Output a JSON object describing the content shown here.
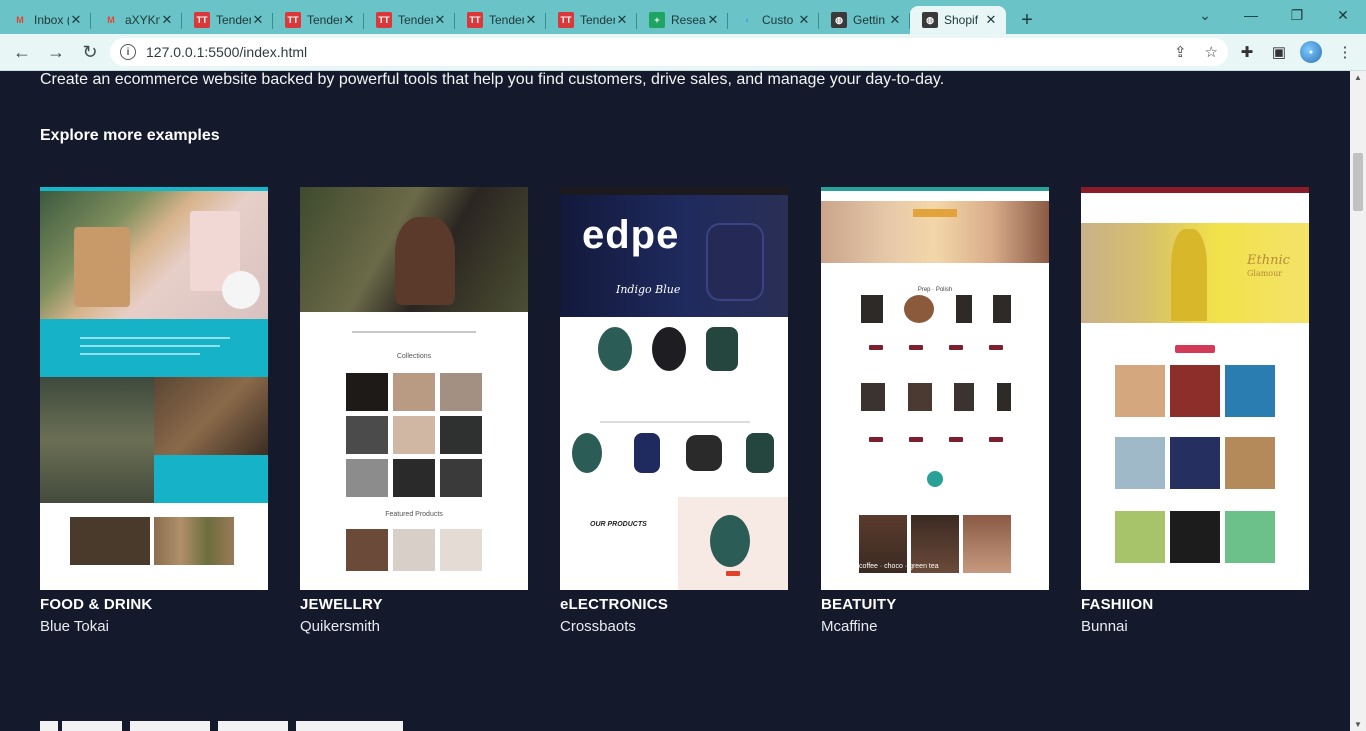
{
  "browser": {
    "tabs": [
      {
        "title": "Inbox (",
        "favicon": "gmail-icon",
        "active": false
      },
      {
        "title": "aXYKn",
        "favicon": "gmail-icon",
        "active": false
      },
      {
        "title": "Tender",
        "favicon": "tt-icon",
        "active": false
      },
      {
        "title": "Tender",
        "favicon": "tt-icon",
        "active": false
      },
      {
        "title": "Tender",
        "favicon": "tt-icon",
        "active": false
      },
      {
        "title": "Tender",
        "favicon": "tt-icon",
        "active": false
      },
      {
        "title": "Tender",
        "favicon": "tt-icon",
        "active": false
      },
      {
        "title": "Resear",
        "favicon": "sheets-icon",
        "active": false
      },
      {
        "title": "Custo",
        "favicon": "customer-icon",
        "active": false
      },
      {
        "title": "Gettin",
        "favicon": "globe-icon",
        "active": false
      },
      {
        "title": "Shopif",
        "favicon": "globe-icon",
        "active": true
      }
    ],
    "new_tab": "+",
    "url": "127.0.0.1:5500/index.html",
    "colors": {
      "tab_strip": "#69c3c7",
      "toolbar": "#e9f6f6"
    }
  },
  "page": {
    "intro": "Create an ecommerce website backed by powerful tools that help you find customers, drive sales, and manage your day-to-day.",
    "explore_heading": "Explore more examples",
    "examples": [
      {
        "category": "FOOD & DRINK",
        "brand": "Blue Tokai"
      },
      {
        "category": "JEWELLRY",
        "brand": "Quikersmith"
      },
      {
        "category": "eLECTRONICS",
        "brand": "Crossbaots"
      },
      {
        "category": "BEATUITY",
        "brand": "Mcaffine"
      },
      {
        "category": "FASHIION",
        "brand": "Bunnai"
      }
    ],
    "thumb_text": {
      "edpe": "edpe",
      "edpe_sub": "Indigo Blue",
      "edpe_products": "OUR PRODUCTS",
      "jewel_collections": "Collections",
      "jewel_featured": "Featured Products",
      "ethnic": "Ethnic",
      "ethnic_sub": "Glamour",
      "beauty_brands": "Prep · Polish",
      "beauty_bottom": "coffee · choco · green tea"
    },
    "colors": {
      "background": "#141a2b",
      "text": "#ffffff"
    }
  }
}
